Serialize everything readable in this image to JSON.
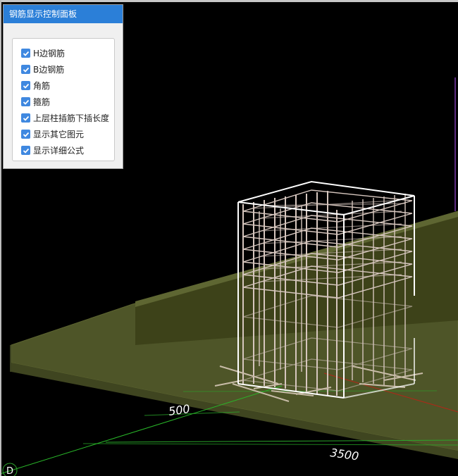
{
  "panel": {
    "title": "钢筋显示控制面板",
    "options": [
      {
        "label": "H边钢筋",
        "checked": true
      },
      {
        "label": "B边钢筋",
        "checked": true
      },
      {
        "label": "角筋",
        "checked": true
      },
      {
        "label": "箍筋",
        "checked": true
      },
      {
        "label": "上层柱插筋下插长度",
        "checked": true
      },
      {
        "label": "显示其它图元",
        "checked": true
      },
      {
        "label": "显示详细公式",
        "checked": true
      }
    ]
  },
  "scene": {
    "dimension_labels": [
      "500",
      "3500"
    ],
    "axis_label": "D",
    "colors": {
      "background": "#000000",
      "slab": "#4c5327",
      "rebar": "#d8c8c0",
      "stirrup": "#ffffff",
      "axis": "#2ea82e",
      "accent": "#c03020"
    }
  }
}
